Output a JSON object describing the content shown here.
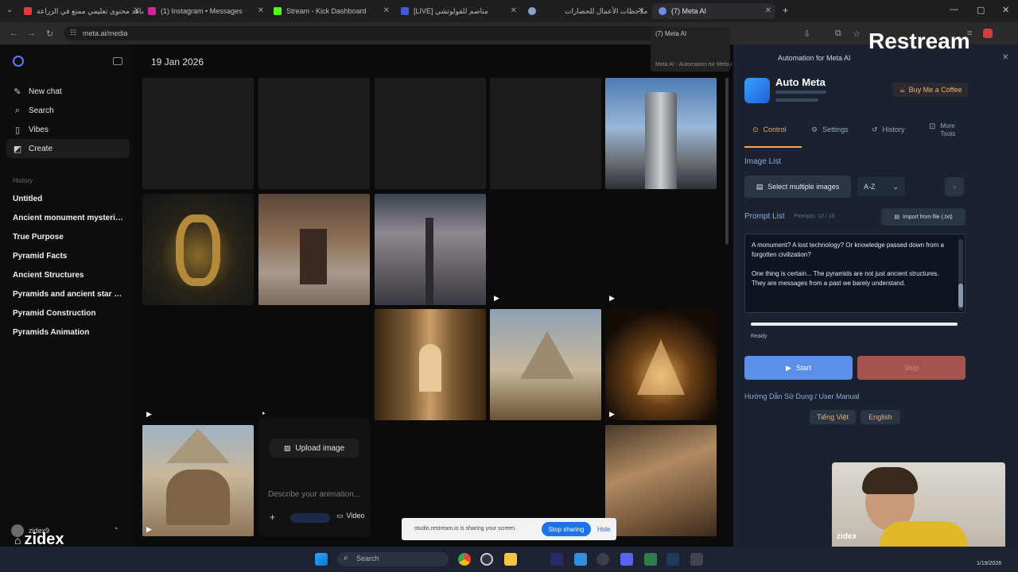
{
  "tabs": [
    {
      "label": "شاهد محتوى تعليمي ممتع في الزراعة",
      "color": "#e53935"
    },
    {
      "label": "(1) Instagram • Messages",
      "color": "#d6249f"
    },
    {
      "label": "Stream - Kick Dashboard",
      "color": "#53fc18"
    },
    {
      "label": "[LIVE] مناصم للفولوتشي",
      "color": "#3b5bdb"
    },
    {
      "label": "",
      "color": "#8aa4c8"
    },
    {
      "label": "ملاحظات الأعمال للحضارات",
      "color": "#7c7c7c"
    },
    {
      "label": "(7) Meta AI",
      "color": "#6c8ee0"
    }
  ],
  "address": {
    "url": "meta.ai/media"
  },
  "sidebar": {
    "items": [
      {
        "label": "New chat",
        "icon": "edit-icon"
      },
      {
        "label": "Search",
        "icon": "search-icon"
      },
      {
        "label": "Vibes",
        "icon": "vibes-icon"
      },
      {
        "label": "Create",
        "icon": "create-icon"
      }
    ],
    "history_heading": "History",
    "history": [
      "Untitled",
      "Ancient monument mysteries",
      "True Purpose",
      "Pyramid Facts",
      "Ancient Structures",
      "Pyramids and ancient star co...",
      "Pyramid Construction",
      "Pyramids Animation"
    ],
    "user": "zidex9"
  },
  "main": {
    "date": "19 Jan 2026",
    "upload_label": "Upload image",
    "prompt_placeholder": "Describe your animation...",
    "video_label": "Video"
  },
  "dropdown": {
    "item1": "(7) Meta AI",
    "item2": "Meta AI - Automation for Meta AI"
  },
  "overlay": {
    "brand": "Restream",
    "watermark": "zidex",
    "cam_name": "zidex"
  },
  "extension": {
    "title": "Auto Meta",
    "subtitle": "Automation for Meta AI",
    "coffee_label": "Buy Me a Coffee",
    "tabs": [
      "Control",
      "Settings",
      "History",
      "More Tools"
    ],
    "image_list_heading": "Image List",
    "select_images_label": "Select multiple images",
    "sort_value": "A-Z",
    "prompt_list_heading": "Prompt List",
    "prompt_count": "Prompts: 10 / 10",
    "import_label": "Import from file (.txt)",
    "prompt_text_1": "A monument? A lost technology? Or knowledge passed down from a forgotten civilization?",
    "prompt_text_2": "One thing is certain... The pyramids are not just ancient structures. They are messages from a past we barely understand.",
    "status": "Ready",
    "start_label": "Start",
    "stop_label": "Stop",
    "manual_heading": "Hướng Dẫn Sử Dụng / User Manual",
    "lang_vi": "Tiếng Việt",
    "lang_en": "English"
  },
  "share_bar": {
    "text": "studio.restream.io is sharing your screen.",
    "stop_label": "Stop sharing",
    "hide_label": "Hide"
  },
  "taskbar": {
    "search_placeholder": "Search",
    "time": "1/19/2026"
  }
}
